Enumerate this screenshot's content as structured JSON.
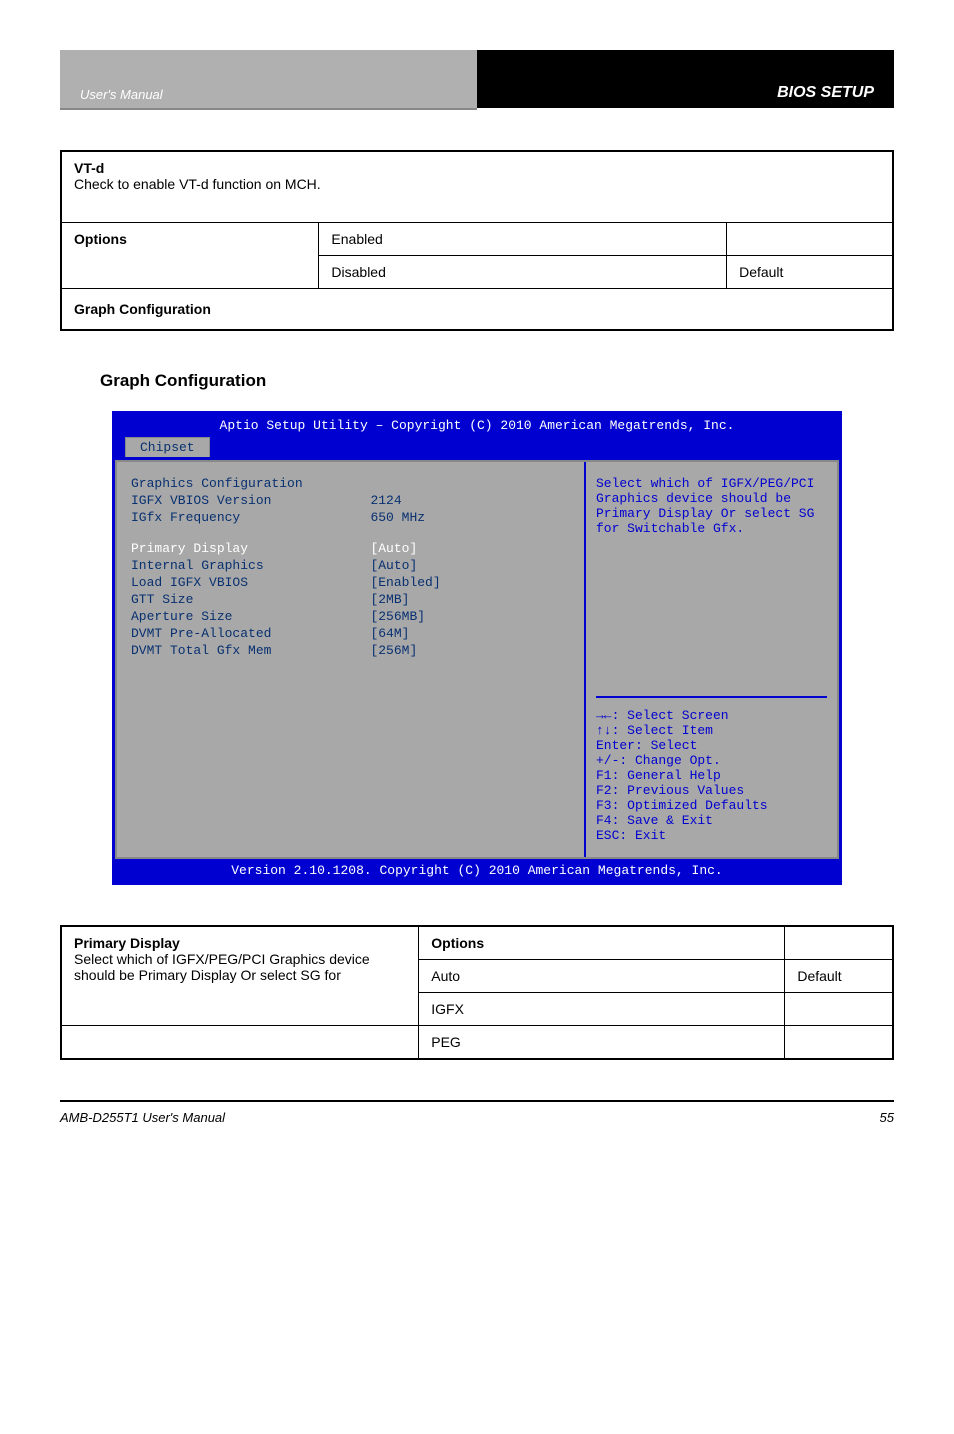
{
  "header": {
    "left": "User's Manual",
    "right": "BIOS SETUP"
  },
  "table1": {
    "desc_label": "VT-d",
    "desc_text": "Check to enable VT-d function on MCH.",
    "option_label": "Options",
    "enabled": "Enabled",
    "disabled": "Disabled",
    "default": "Default",
    "graph_conf": "Graph Configuration"
  },
  "section_title": "Graph Configuration",
  "bios": {
    "top": "Aptio Setup Utility – Copyright (C) 2010 American Megatrends, Inc.",
    "tab": "Chipset",
    "rows": {
      "heading": "Graphics Configuration",
      "r1l": "IGFX VBIOS Version",
      "r1v": "2124",
      "r2l": "IGfx Frequency",
      "r2v": "650 MHz",
      "r3l": "Primary Display",
      "r3v": "[Auto]",
      "r4l": "Internal Graphics",
      "r4v": "[Auto]",
      "r5l": "Load IGFX VBIOS",
      "r5v": "[Enabled]",
      "r6l": "GTT Size",
      "r6v": "[2MB]",
      "r7l": "Aperture Size",
      "r7v": "[256MB]",
      "r8l": "DVMT Pre-Allocated",
      "r8v": "[64M]",
      "r9l": "DVMT Total Gfx Mem",
      "r9v": "[256M]"
    },
    "help": "Select which of IGFX/PEG/PCI Graphics device should be Primary Display Or select SG for Switchable Gfx.",
    "keys": {
      "k1": "→←: Select Screen",
      "k2": "↑↓: Select Item",
      "k3": "Enter: Select",
      "k4": "+/-: Change Opt.",
      "k5": "F1: General Help",
      "k6": "F2: Previous Values",
      "k7": "F3: Optimized Defaults",
      "k8": "F4: Save & Exit",
      "k9": "ESC: Exit"
    },
    "bottom": "Version 2.10.1208. Copyright (C) 2010 American Megatrends, Inc."
  },
  "table2": {
    "desc_label": "Primary Display",
    "desc_text": "Select which of IGFX/PEG/PCI Graphics device should be Primary Display Or select SG for",
    "option_label": "Options",
    "auto": "Auto",
    "default": "Default",
    "igfx": "IGFX",
    "peg": "PEG"
  },
  "footer": {
    "left": "AMB-D255T1 User's Manual",
    "right": "55"
  }
}
